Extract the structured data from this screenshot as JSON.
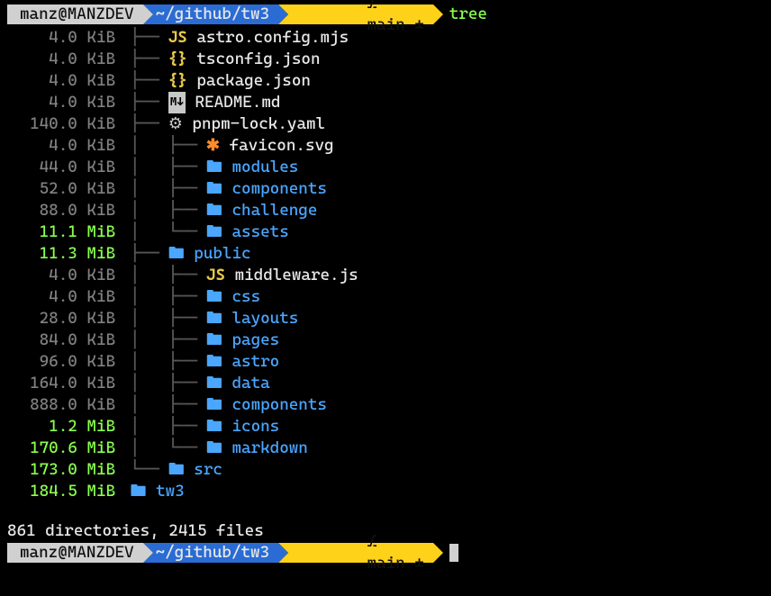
{
  "prompt": {
    "host": "manz@MANZDEV",
    "path": "~/github/tw3",
    "branch_icon": "⎇",
    "branch": "main ±",
    "command": "tree"
  },
  "tree": [
    {
      "size": "4.0",
      "unit": "KiB",
      "depth": 0,
      "tee": "├── ",
      "icon": "js",
      "name": "astro.config.mjs",
      "type": "file"
    },
    {
      "size": "4.0",
      "unit": "KiB",
      "depth": 0,
      "tee": "├── ",
      "icon": "json",
      "name": "tsconfig.json",
      "type": "file"
    },
    {
      "size": "4.0",
      "unit": "KiB",
      "depth": 0,
      "tee": "├── ",
      "icon": "json",
      "name": "package.json",
      "type": "file"
    },
    {
      "size": "4.0",
      "unit": "KiB",
      "depth": 0,
      "tee": "├── ",
      "icon": "md",
      "name": "README.md",
      "type": "file"
    },
    {
      "size": "140.0",
      "unit": "KiB",
      "depth": 0,
      "tee": "├── ",
      "icon": "gear",
      "name": "pnpm-lock.yaml",
      "type": "file"
    },
    {
      "size": "4.0",
      "unit": "KiB",
      "depth": 1,
      "tee": "├── ",
      "icon": "star",
      "name": "favicon.svg",
      "type": "file"
    },
    {
      "size": "44.0",
      "unit": "KiB",
      "depth": 1,
      "tee": "├── ",
      "icon": "folder",
      "name": "modules",
      "type": "dir"
    },
    {
      "size": "52.0",
      "unit": "KiB",
      "depth": 1,
      "tee": "├── ",
      "icon": "folder",
      "name": "components",
      "type": "dir"
    },
    {
      "size": "88.0",
      "unit": "KiB",
      "depth": 1,
      "tee": "├── ",
      "icon": "folder",
      "name": "challenge",
      "type": "dir"
    },
    {
      "size": "11.1",
      "unit": "MiB",
      "depth": 1,
      "tee": "└── ",
      "icon": "folder",
      "name": "assets",
      "type": "dir"
    },
    {
      "size": "11.3",
      "unit": "MiB",
      "depth": 0,
      "tee": "├── ",
      "icon": "folder",
      "name": "public",
      "type": "dir"
    },
    {
      "size": "4.0",
      "unit": "KiB",
      "depth": 1,
      "tee": "├── ",
      "icon": "js",
      "name": "middleware.js",
      "type": "file"
    },
    {
      "size": "4.0",
      "unit": "KiB",
      "depth": 1,
      "tee": "├── ",
      "icon": "folder",
      "name": "css",
      "type": "dir"
    },
    {
      "size": "28.0",
      "unit": "KiB",
      "depth": 1,
      "tee": "├── ",
      "icon": "folder",
      "name": "layouts",
      "type": "dir"
    },
    {
      "size": "84.0",
      "unit": "KiB",
      "depth": 1,
      "tee": "├── ",
      "icon": "folder",
      "name": "pages",
      "type": "dir"
    },
    {
      "size": "96.0",
      "unit": "KiB",
      "depth": 1,
      "tee": "├── ",
      "icon": "folder",
      "name": "astro",
      "type": "dir"
    },
    {
      "size": "164.0",
      "unit": "KiB",
      "depth": 1,
      "tee": "├── ",
      "icon": "folder",
      "name": "data",
      "type": "dir"
    },
    {
      "size": "888.0",
      "unit": "KiB",
      "depth": 1,
      "tee": "├── ",
      "icon": "folder",
      "name": "components",
      "type": "dir"
    },
    {
      "size": "1.2",
      "unit": "MiB",
      "depth": 1,
      "tee": "├── ",
      "icon": "folder",
      "name": "icons",
      "type": "dir"
    },
    {
      "size": "170.6",
      "unit": "MiB",
      "depth": 1,
      "tee": "└── ",
      "icon": "folder",
      "name": "markdown",
      "type": "dir"
    },
    {
      "size": "173.0",
      "unit": "MiB",
      "depth": 0,
      "tee": "└── ",
      "icon": "folder",
      "name": "src",
      "type": "dir"
    },
    {
      "size": "184.5",
      "unit": "MiB",
      "depth": -1,
      "tee": "",
      "icon": "folder",
      "name": "tw3",
      "type": "dir"
    }
  ],
  "summary": "861 directories, 2415 files",
  "icon_glyphs": {
    "js": "JS",
    "json": "{}",
    "md": "M↓",
    "gear": "⚙",
    "star": "✱",
    "folder": "🖿"
  }
}
